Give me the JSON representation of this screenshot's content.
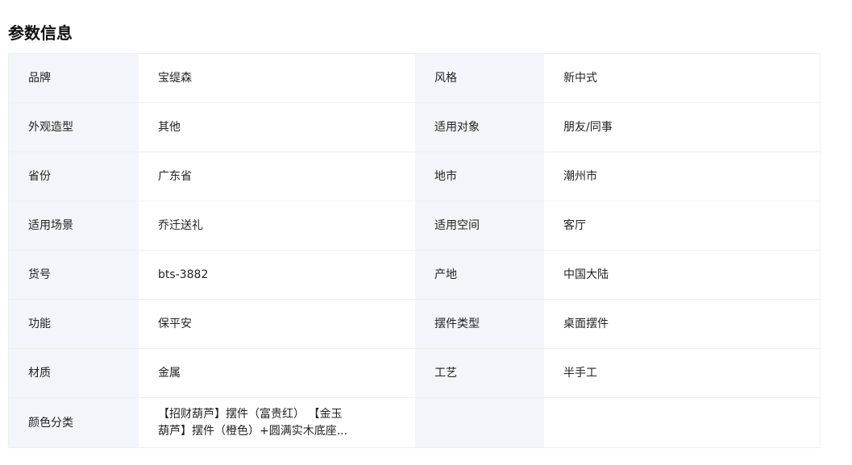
{
  "section": {
    "title": "参数信息"
  },
  "params": {
    "rows": [
      {
        "label1": "品牌",
        "value1": "宝缇森",
        "label2": "风格",
        "value2": "新中式"
      },
      {
        "label1": "外观造型",
        "value1": "其他",
        "label2": "适用对象",
        "value2": "朋友/同事"
      },
      {
        "label1": "省份",
        "value1": "广东省",
        "label2": "地市",
        "value2": "潮州市"
      },
      {
        "label1": "适用场景",
        "value1": "乔迁送礼",
        "label2": "适用空间",
        "value2": "客厅"
      },
      {
        "label1": "货号",
        "value1": "bts-3882",
        "label2": "产地",
        "value2": "中国大陆"
      },
      {
        "label1": "功能",
        "value1": "保平安",
        "label2": "摆件类型",
        "value2": "桌面摆件"
      },
      {
        "label1": "材质",
        "value1": "金属",
        "label2": "工艺",
        "value2": "半手工"
      },
      {
        "label1": "颜色分类",
        "value1": "【招财葫芦】摆件（富贵红） 【金玉葫芦】摆件（橙色）+圆满实木底座...",
        "label2": "",
        "value2": ""
      }
    ]
  }
}
